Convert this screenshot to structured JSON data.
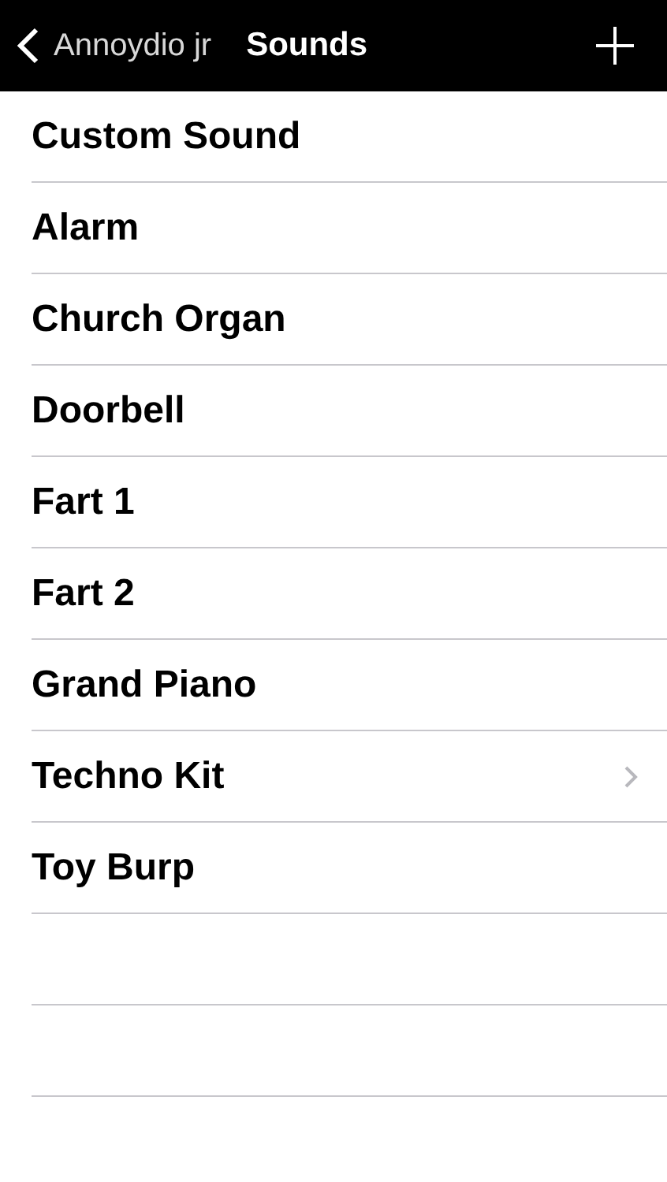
{
  "nav_bar": {
    "back_label": "Annoydio jr",
    "title": "Sounds"
  },
  "sounds": [
    {
      "name": "Custom Sound",
      "disclosure": false
    },
    {
      "name": "Alarm",
      "disclosure": false
    },
    {
      "name": "Church Organ",
      "disclosure": false
    },
    {
      "name": "Doorbell",
      "disclosure": false
    },
    {
      "name": "Fart 1",
      "disclosure": false
    },
    {
      "name": "Fart 2",
      "disclosure": false
    },
    {
      "name": "Grand Piano",
      "disclosure": false
    },
    {
      "name": "Techno Kit",
      "disclosure": true
    },
    {
      "name": "Toy Burp",
      "disclosure": false
    }
  ]
}
